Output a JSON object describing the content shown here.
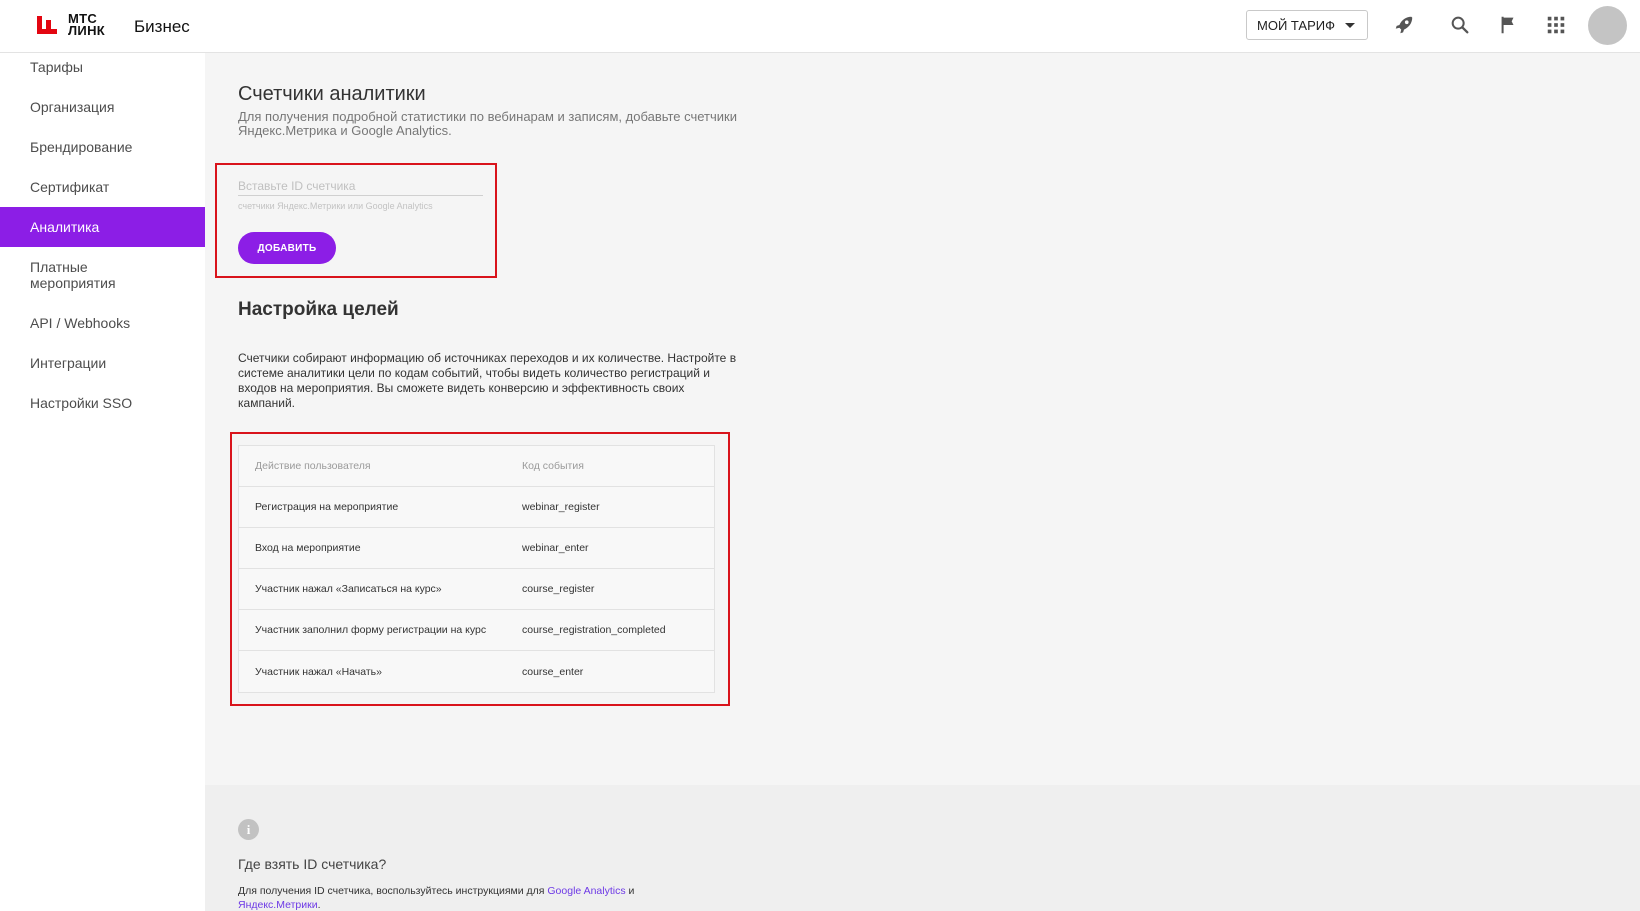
{
  "header": {
    "logo_line1": "МТС",
    "logo_line2": "ЛИНК",
    "product": "Бизнес",
    "tariff_label": "МОЙ ТАРИФ",
    "icons": [
      "rocket-icon",
      "search-icon",
      "flag-icon",
      "apps-grid-icon",
      "avatar"
    ],
    "brand_red": "#e30611"
  },
  "sidebar": {
    "items": [
      {
        "label": "Тарифы"
      },
      {
        "label": "Организация"
      },
      {
        "label": "Брендирование"
      },
      {
        "label": "Сертификат"
      },
      {
        "label": "Аналитика",
        "active": true
      },
      {
        "label": "Платные мероприятия"
      },
      {
        "label": "API / Webhooks"
      },
      {
        "label": "Интеграции"
      },
      {
        "label": "Настройки SSO"
      }
    ],
    "accent": "#8c1ee6"
  },
  "counters": {
    "title": "Счетчики аналитики",
    "subtitle": "Для получения подробной статистики по вебинарам и записям, добавьте счетчики Яндекс.Метрика и Google Analytics.",
    "input_placeholder": "Вставьте ID счетчика",
    "input_hint": "счетчики Яндекс.Метрики или Google Analytics",
    "add_label": "ДОБАВИТЬ"
  },
  "goals": {
    "title": "Настройка целей",
    "description": "Счетчики собирают информацию об источниках переходов и их количестве. Настройте в системе аналитики цели по кодам событий, чтобы видеть количество регистраций и входов на мероприятия. Вы сможете видеть конверсию и эффективность своих кампаний.",
    "table": {
      "headers": [
        "Действие пользователя",
        "Код события"
      ],
      "rows": [
        [
          "Регистрация на мероприятие",
          "webinar_register"
        ],
        [
          "Вход на мероприятие",
          "webinar_enter"
        ],
        [
          "Участник нажал «Записаться на курс»",
          "course_register"
        ],
        [
          "Участник заполнил форму регистрации на курс",
          "course_registration_completed"
        ],
        [
          "Участник нажал «Начать»",
          "course_enter"
        ]
      ]
    }
  },
  "footer": {
    "info_glyph": "i",
    "title": "Где взять ID счетчика?",
    "text_prefix": "Для получения ID счетчика, воспользуйтесь инструкциями для",
    "link_ga": "Google Analytics",
    "text_and": "и",
    "link_ym": "Яндекс.Метрики",
    "text_suffix": "."
  }
}
